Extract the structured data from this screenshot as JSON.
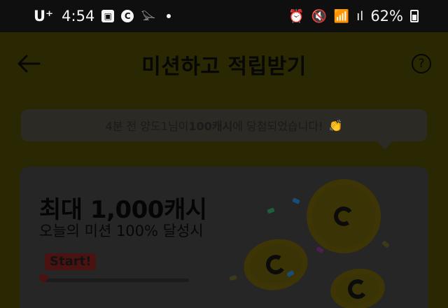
{
  "status_bar": {
    "carrier": "U⁺",
    "time": "4:54",
    "battery": "62%"
  },
  "header": {
    "title": "미션하고 적립받기",
    "help": "?"
  },
  "notice": {
    "prefix": "4분 전 양도1님이 ",
    "amount": "100캐시",
    "suffix": "에 당첨되었습니다!",
    "emoji": "👏"
  },
  "card": {
    "title": "최대 1,000캐시",
    "subtitle": "오늘의 미션 100% 달성시",
    "start_label": "Start!",
    "progress": 0.0
  },
  "icons": {
    "back": "arrow-left-icon",
    "help": "question-icon",
    "gallery": "image-icon",
    "circle_c": "c-icon",
    "bird": "bird-icon",
    "alarm": "alarm-icon",
    "mute": "mute-icon",
    "wifi": "wifi-icon",
    "signal": "signal-icon",
    "battery": "battery-icon"
  },
  "colors": {
    "screen_overlay": "#2a2703",
    "accent": "#3a3306"
  }
}
